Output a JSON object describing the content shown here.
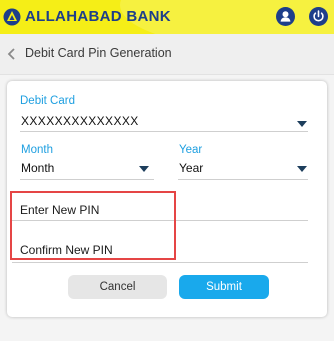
{
  "app_bar": {
    "bank_name": "ALLAHABAD BANK",
    "logo_icon": "bank-logo-icon",
    "profile_icon": "user-icon",
    "power_icon": "power-icon",
    "background_color": "#f5ee17",
    "brand_color": "#1d3e8a"
  },
  "header": {
    "back_icon": "chevron-left-icon",
    "title": "Debit Card Pin Generation"
  },
  "form": {
    "debit_card": {
      "label": "Debit Card",
      "value": "XXXXXXXXXXXXXX"
    },
    "month": {
      "label": "Month",
      "value": "Month"
    },
    "year": {
      "label": "Year",
      "value": "Year"
    },
    "new_pin_placeholder": "Enter New PIN",
    "confirm_pin_placeholder": "Confirm New PIN",
    "accent_color": "#1e9fe0",
    "highlight_color": "#e54545"
  },
  "buttons": {
    "cancel_label": "Cancel",
    "submit_label": "Submit",
    "submit_color": "#19a9ec"
  }
}
